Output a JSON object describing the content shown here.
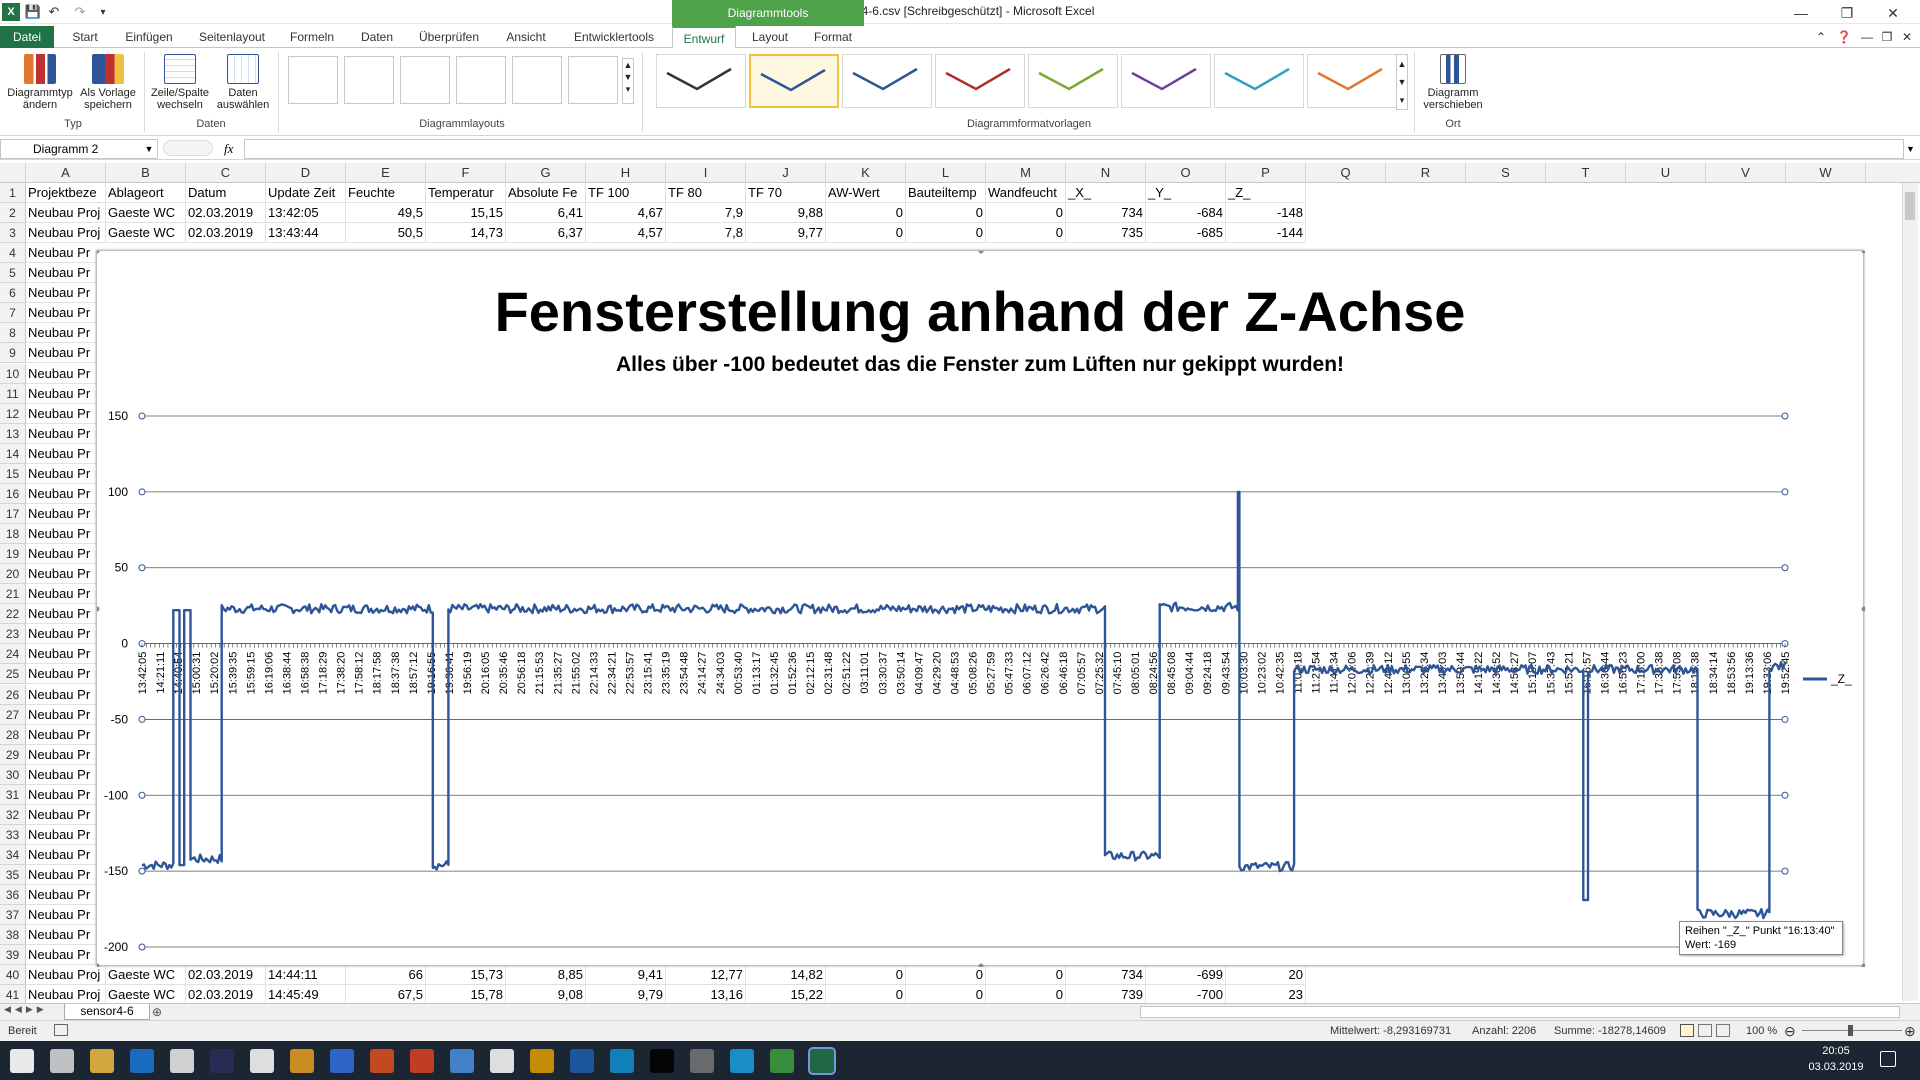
{
  "window": {
    "title": "sensor4-6.csv  [Schreibgeschützt]  -  Microsoft Excel",
    "context_tab": "Diagrammtools"
  },
  "tabs": [
    "Datei",
    "Start",
    "Einfügen",
    "Seitenlayout",
    "Formeln",
    "Daten",
    "Überprüfen",
    "Ansicht",
    "Entwicklertools",
    "Entwurf",
    "Layout",
    "Format"
  ],
  "ribbon": {
    "btn_change_type": "Diagrammtyp ändern",
    "btn_save_template": "Als Vorlage speichern",
    "btn_switch": "Zeile/Spalte wechseln",
    "btn_select_data": "Daten auswählen",
    "btn_move": "Diagramm verschieben",
    "grp_typ": "Typ",
    "grp_daten": "Daten",
    "grp_layouts": "Diagrammlayouts",
    "grp_styles": "Diagrammformatvorlagen",
    "grp_ort": "Ort",
    "style_colors": [
      "#333333",
      "#2e5597",
      "#2e5597",
      "#b03030",
      "#7aa830",
      "#7040a0",
      "#30a0c0",
      "#e07830"
    ]
  },
  "formula": {
    "namebox": "Diagramm 2",
    "fx": "fx"
  },
  "columns": [
    "A",
    "B",
    "C",
    "D",
    "E",
    "F",
    "G",
    "H",
    "I",
    "J",
    "K",
    "L",
    "M",
    "N",
    "O",
    "P",
    "Q",
    "R",
    "S",
    "T",
    "U",
    "V",
    "W"
  ],
  "header_row": [
    "Projektbeze",
    "Ablageort",
    "Datum",
    "Update Zeit",
    "Feuchte",
    "Temperatur",
    "Absolute Fe",
    "TF 100",
    "TF 80",
    "TF 70",
    "AW-Wert",
    "Bauteiltemp",
    "Wandfeucht",
    "_X_",
    "_Y_",
    "_Z_"
  ],
  "rows": [
    {
      "n": "2",
      "cells": [
        "Neubau Proj",
        "Gaeste WC",
        "02.03.2019",
        "13:42:05",
        "49,5",
        "15,15",
        "6,41",
        "4,67",
        "7,9",
        "9,88",
        "0",
        "0",
        "0",
        "734",
        "-684",
        "-148"
      ]
    },
    {
      "n": "3",
      "cells": [
        "Neubau Proj",
        "Gaeste WC",
        "02.03.2019",
        "13:43:44",
        "50,5",
        "14,73",
        "6,37",
        "4,57",
        "7,8",
        "9,77",
        "0",
        "0",
        "0",
        "735",
        "-685",
        "-144"
      ]
    },
    {
      "n": "40",
      "cells": [
        "Neubau Proj",
        "Gaeste WC",
        "02.03.2019",
        "14:44:11",
        "66",
        "15,73",
        "8,85",
        "9,41",
        "12,77",
        "14,82",
        "0",
        "0",
        "0",
        "734",
        "-699",
        "20"
      ]
    },
    {
      "n": "41",
      "cells": [
        "Neubau Proj",
        "Gaeste WC",
        "02.03.2019",
        "14:45:49",
        "67,5",
        "15,78",
        "9,08",
        "9,79",
        "13,16",
        "15,22",
        "0",
        "0",
        "0",
        "739",
        "-700",
        "23"
      ]
    }
  ],
  "partial_col_a": "Neubau Pr",
  "chart_data": {
    "type": "line",
    "title": "Fensterstellung anhand der Z-Achse",
    "subtitle": "Alles über -100  bedeutet das die Fenster zum Lüften nur gekippt wurden!",
    "ylim": [
      -200,
      150
    ],
    "yticks": [
      "150",
      "100",
      "50",
      "0",
      "-50",
      "-100",
      "-150",
      "-200"
    ],
    "legend": "top-right",
    "grid": true,
    "series": [
      {
        "name": "_Z_",
        "color": "#2e5597"
      }
    ],
    "segments": [
      {
        "level": -146,
        "span": 2
      },
      {
        "level": 22,
        "span": 0.4
      },
      {
        "level": -146,
        "span": 0.3
      },
      {
        "level": 22,
        "span": 0.4
      },
      {
        "level": -142,
        "span": 2
      },
      {
        "level": 23,
        "span": 13.5
      },
      {
        "level": -146,
        "span": 1
      },
      {
        "level": 23,
        "span": 42
      },
      {
        "level": -140,
        "span": 3.5
      },
      {
        "level": 24,
        "span": 5
      },
      {
        "level": 100,
        "span": 0.1
      },
      {
        "level": -147,
        "span": 3.5
      },
      {
        "level": -17,
        "span": 18.5
      },
      {
        "level": -169,
        "span": 0.3
      },
      {
        "level": -17,
        "span": 7
      },
      {
        "level": -178,
        "span": 4.6
      },
      {
        "level": -15,
        "span": 1
      }
    ],
    "x_labels": [
      "13:42:05",
      "14:21:11",
      "14:40:54",
      "15:00:31",
      "15:20:02",
      "15:39:35",
      "15:59:15",
      "16:19:06",
      "16:38:44",
      "16:58:38",
      "17:18:29",
      "17:38:20",
      "17:58:12",
      "18:17:58",
      "18:37:38",
      "18:57:12",
      "19:16:55",
      "19:36:41",
      "19:56:19",
      "20:16:05",
      "20:35:46",
      "20:56:18",
      "21:15:53",
      "21:35:27",
      "21:55:02",
      "22:14:33",
      "22:34:21",
      "22:53:57",
      "23:15:41",
      "23:35:19",
      "23:54:48",
      "24:14:27",
      "24:34:03",
      "00:53:40",
      "01:13:17",
      "01:32:45",
      "01:52:36",
      "02:12:15",
      "02:31:48",
      "02:51:22",
      "03:11:01",
      "03:30:37",
      "03:50:14",
      "04:09:47",
      "04:29:20",
      "04:48:53",
      "05:08:26",
      "05:27:59",
      "05:47:33",
      "06:07:12",
      "06:26:42",
      "06:46:18",
      "07:05:57",
      "07:25:32",
      "07:45:10",
      "08:05:01",
      "08:24:56",
      "08:45:08",
      "09:04:44",
      "09:24:18",
      "09:43:54",
      "10:03:30",
      "10:23:02",
      "10:42:35",
      "11:02:18",
      "11:21:54",
      "11:41:34",
      "12:01:06",
      "12:20:39",
      "12:40:12",
      "13:00:55",
      "13:20:34",
      "13:40:03",
      "13:59:44",
      "14:19:22",
      "14:38:52",
      "14:58:27",
      "15:18:07",
      "15:37:43",
      "15:57:21",
      "16:16:57",
      "16:36:44",
      "16:56:23",
      "17:16:00",
      "17:35:38",
      "17:55:08",
      "18:14:38",
      "18:34:14",
      "18:53:56",
      "19:13:36",
      "19:33:06",
      "19:52:45"
    ]
  },
  "tooltip": {
    "line1": "Reihen \"_Z_\" Punkt \"16:13:40\"",
    "line2": "Wert: -169"
  },
  "sheet": {
    "name": "sensor4-6"
  },
  "status": {
    "ready": "Bereit",
    "avg": "Mittelwert: -8,293169731",
    "count": "Anzahl: 2206",
    "sum": "Summe: -18278,14609",
    "zoom": "100 %"
  },
  "clock": {
    "time": "20:05",
    "date": "03.03.2019"
  }
}
